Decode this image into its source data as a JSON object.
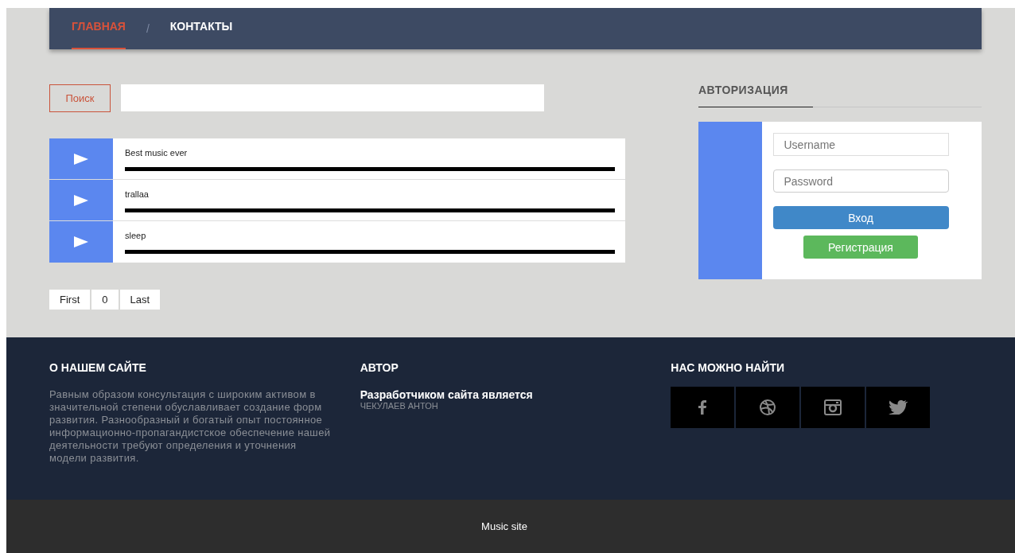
{
  "nav": {
    "separator": "/",
    "items": [
      {
        "label": "ГЛАВНАЯ",
        "selected": true
      },
      {
        "label": "КОНТАКТЫ",
        "selected": false
      }
    ]
  },
  "search": {
    "button": "Поиск"
  },
  "tracks": [
    {
      "title": "Best music ever"
    },
    {
      "title": "trallaa"
    },
    {
      "title": "sleep"
    }
  ],
  "pagination": [
    "First",
    "0",
    "Last"
  ],
  "auth": {
    "title": "АВТОРИЗАЦИЯ",
    "username_placeholder": "Username",
    "password_placeholder": "Password",
    "login": "Вход",
    "register": "Регистрация"
  },
  "footer": {
    "about_title": "О НАШЕМ САЙТЕ",
    "about_text": "Равным образом консультация с широким активом в значительной степени обуславливает создание форм развития. Разнообразный и богатый опыт постоянное информационно-пропагандистское обеспечение нашей деятельности требуют определения и уточнения модели развития.",
    "author_title": "АВТОР",
    "author_line": "Разработчиком сайта является",
    "author_name": "ЧЕКУЛАЕВ АНТОН",
    "social_title": "НАС МОЖНО НАЙТИ"
  },
  "bottom_bar": "Music site"
}
